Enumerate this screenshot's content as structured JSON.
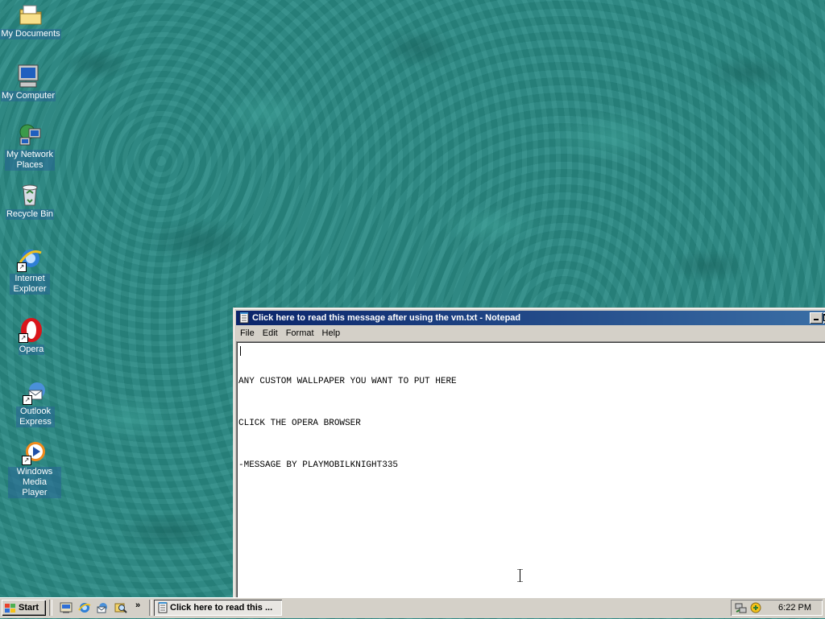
{
  "desktop": {
    "icons": [
      {
        "label": "My Documents"
      },
      {
        "label": "My Computer"
      },
      {
        "label": "My Network Places"
      },
      {
        "label": "Recycle Bin"
      },
      {
        "label": "Internet Explorer"
      },
      {
        "label": "Opera"
      },
      {
        "label": "Outlook Express"
      },
      {
        "label": "Windows Media Player"
      }
    ]
  },
  "notepad": {
    "title": "Click here to read this message after using the vm.txt - Notepad",
    "menu": [
      "File",
      "Edit",
      "Format",
      "Help"
    ],
    "lines": [
      "ANY CUSTOM WALLPAPER YOU WANT TO PUT HERE",
      "CLICK THE OPERA BROWSER",
      "-MESSAGE BY PLAYMOBILKNIGHT335"
    ]
  },
  "taskbar": {
    "start_label": "Start",
    "quick_launch": [
      "show-desktop-icon",
      "internet-explorer-icon",
      "outlook-express-icon",
      "search-icon"
    ],
    "overflow": "»",
    "task_button_label": "Click here to read this ...",
    "clock": "6:22 PM"
  },
  "colors": {
    "desktop": "#2a8a84",
    "titlebar_start": "#0a246a",
    "titlebar_end": "#3a6ea5",
    "chrome": "#d4d0c8"
  }
}
